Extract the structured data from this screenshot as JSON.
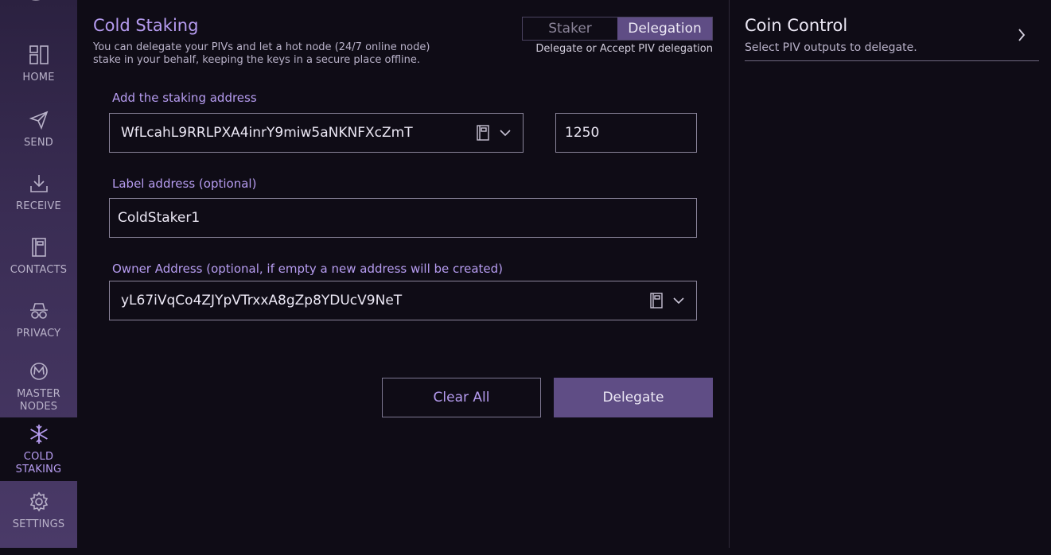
{
  "sidebar": {
    "items": [
      {
        "label": "HOME",
        "icon": "home-icon"
      },
      {
        "label": "SEND",
        "icon": "send-icon"
      },
      {
        "label": "RECEIVE",
        "icon": "receive-icon"
      },
      {
        "label": "CONTACTS",
        "icon": "contacts-icon"
      },
      {
        "label": "PRIVACY",
        "icon": "privacy-icon"
      },
      {
        "label": "MASTER\nNODES",
        "icon": "masternodes-icon"
      },
      {
        "label": "COLD\nSTAKING",
        "icon": "snowflake-icon",
        "active": true
      },
      {
        "label": "SETTINGS",
        "icon": "gear-icon"
      }
    ]
  },
  "main": {
    "title": "Cold Staking",
    "description": "You can delegate your PIVs and let a hot node (24/7 online node) stake in your behalf, keeping the keys in a secure place offline.",
    "toggle": {
      "staker": "Staker",
      "delegation": "Delegation",
      "selected": "Delegation"
    },
    "toggle_caption": "Delegate or Accept PIV delegation",
    "staking_address_label": "Add the staking address",
    "staking_address_value": "WfLcahL9RRLPXA4inrY9miw5aNKNFXcZmT",
    "amount_value": "1250",
    "label_address_label": "Label address (optional)",
    "label_address_value": "ColdStaker1",
    "owner_address_label": "Owner Address (optional, if empty a new address will be created)",
    "owner_address_value": "yL67iVqCo4ZJYpVTrxxA8gZp8YDUcV9NeT",
    "clear_button": "Clear All",
    "delegate_button": "Delegate"
  },
  "coin_control": {
    "title": "Coin Control",
    "subtitle": "Select PIV outputs to delegate."
  },
  "colors": {
    "accent": "#b69cf0",
    "button_fill": "#5f4d85",
    "background": "#0f0c16"
  }
}
